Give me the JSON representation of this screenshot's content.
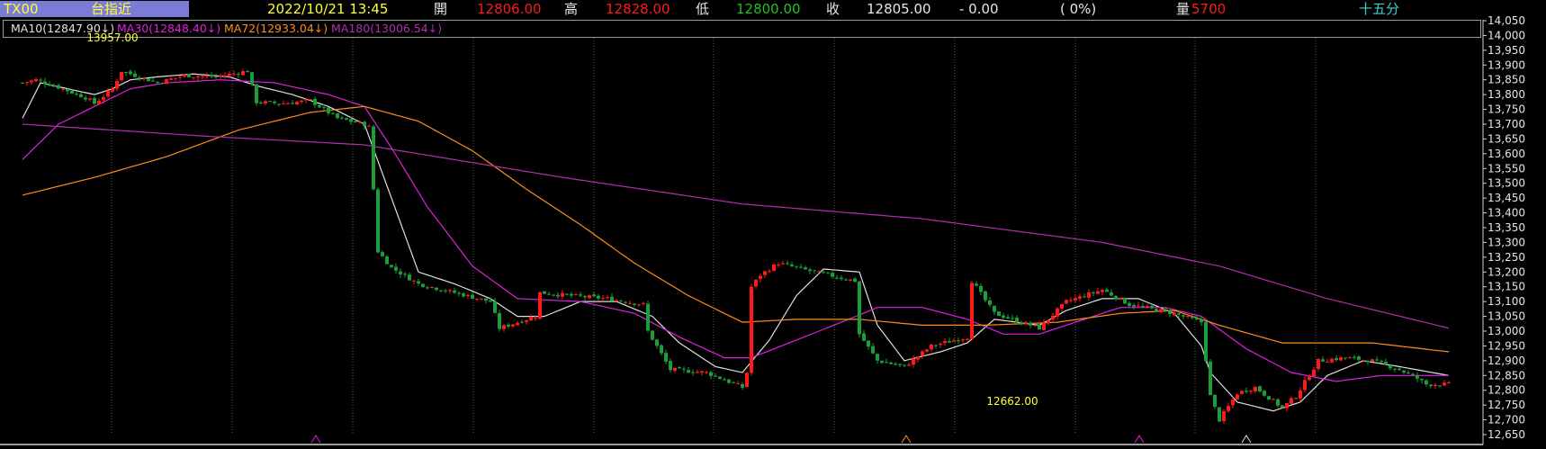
{
  "header": {
    "symbol": "TX00",
    "name": "台指近",
    "datetime": "2022/10/21 13:45",
    "open_label": "開",
    "open": "12806.00",
    "high_label": "高",
    "high": "12828.00",
    "low_label": "低",
    "low": "12800.00",
    "close_label": "收",
    "close": "12805.00",
    "change": "- 0.00",
    "change_pct": "( 0%)",
    "volume_label": "量",
    "volume": "5700",
    "period": "十五分"
  },
  "ma_legend": [
    {
      "label": "MA10",
      "value": "(12847.90↓)",
      "color": "#e0e0e0"
    },
    {
      "label": "MA30",
      "value": "(12848.40↓)",
      "color": "#e020e0"
    },
    {
      "label": "MA72",
      "value": "(12933.04↓)",
      "color": "#ff8c1a"
    },
    {
      "label": "MA180",
      "value": "(13006.54↓)",
      "color": "#b02fb0"
    }
  ],
  "colors": {
    "up": "#ff1a1a",
    "down": "#1a9e3a",
    "grid": "#5a5a5a",
    "accent": "#ffff33"
  },
  "chart_data": {
    "type": "candlestick",
    "ylim": [
      12650,
      14050
    ],
    "y_ticks": [
      "12,650",
      "12,700",
      "12,750",
      "12,800",
      "12,850",
      "12,900",
      "12,950",
      "13,000",
      "13,050",
      "13,100",
      "13,150",
      "13,200",
      "13,250",
      "13,300",
      "13,350",
      "13,400",
      "13,450",
      "13,500",
      "13,550",
      "13,600",
      "13,650",
      "13,700",
      "13,750",
      "13,800",
      "13,850",
      "13,900",
      "13,950",
      "14,000",
      "14,050"
    ],
    "annotations": [
      {
        "text": "13957.00",
        "bar": 20,
        "kind": "high"
      },
      {
        "text": "12662.00",
        "bar": 220,
        "kind": "low"
      }
    ],
    "candle_path": [
      [
        0,
        13840
      ],
      [
        3,
        13850
      ],
      [
        8,
        13825
      ],
      [
        14,
        13790
      ],
      [
        16,
        13770
      ],
      [
        20,
        13820
      ],
      [
        22,
        13880
      ],
      [
        26,
        13860
      ],
      [
        30,
        13840
      ],
      [
        36,
        13865
      ],
      [
        43,
        13860
      ],
      [
        50,
        13880
      ],
      [
        52,
        13775
      ],
      [
        58,
        13770
      ],
      [
        64,
        13780
      ],
      [
        70,
        13720
      ],
      [
        76,
        13700
      ],
      [
        77,
        13690
      ],
      [
        79,
        13270
      ],
      [
        82,
        13215
      ],
      [
        88,
        13160
      ],
      [
        96,
        13130
      ],
      [
        104,
        13100
      ],
      [
        106,
        13010
      ],
      [
        114,
        13050
      ],
      [
        115,
        13130
      ],
      [
        122,
        13120
      ],
      [
        130,
        13110
      ],
      [
        138,
        13090
      ],
      [
        139,
        13000
      ],
      [
        144,
        12870
      ],
      [
        152,
        12860
      ],
      [
        160,
        12810
      ],
      [
        161,
        12860
      ],
      [
        162,
        13150
      ],
      [
        164,
        13190
      ],
      [
        168,
        13230
      ],
      [
        176,
        13200
      ],
      [
        185,
        13170
      ],
      [
        186,
        12990
      ],
      [
        190,
        12900
      ],
      [
        196,
        12880
      ],
      [
        202,
        12950
      ],
      [
        210,
        12980
      ],
      [
        211,
        13170
      ],
      [
        216,
        13060
      ],
      [
        226,
        13010
      ],
      [
        232,
        13100
      ],
      [
        240,
        13140
      ],
      [
        246,
        13090
      ],
      [
        256,
        13060
      ],
      [
        262,
        13030
      ],
      [
        264,
        12780
      ],
      [
        266,
        12700
      ],
      [
        270,
        12790
      ],
      [
        274,
        12810
      ],
      [
        280,
        12740
      ],
      [
        283,
        12780
      ],
      [
        288,
        12900
      ],
      [
        294,
        12910
      ],
      [
        300,
        12900
      ],
      [
        306,
        12870
      ],
      [
        310,
        12840
      ],
      [
        312,
        12820
      ],
      [
        317,
        12820
      ]
    ],
    "ma_series": [
      {
        "name": "MA10",
        "color": "#e0e0e0",
        "path": [
          [
            0,
            13720
          ],
          [
            4,
            13840
          ],
          [
            10,
            13820
          ],
          [
            16,
            13800
          ],
          [
            20,
            13820
          ],
          [
            24,
            13850
          ],
          [
            30,
            13860
          ],
          [
            38,
            13870
          ],
          [
            46,
            13860
          ],
          [
            52,
            13830
          ],
          [
            60,
            13800
          ],
          [
            68,
            13760
          ],
          [
            76,
            13700
          ],
          [
            82,
            13450
          ],
          [
            88,
            13200
          ],
          [
            96,
            13160
          ],
          [
            104,
            13110
          ],
          [
            110,
            13050
          ],
          [
            116,
            13050
          ],
          [
            124,
            13100
          ],
          [
            132,
            13100
          ],
          [
            140,
            13050
          ],
          [
            146,
            12960
          ],
          [
            154,
            12880
          ],
          [
            160,
            12860
          ],
          [
            166,
            12970
          ],
          [
            172,
            13120
          ],
          [
            178,
            13210
          ],
          [
            186,
            13200
          ],
          [
            190,
            13020
          ],
          [
            196,
            12900
          ],
          [
            204,
            12930
          ],
          [
            210,
            12960
          ],
          [
            216,
            13040
          ],
          [
            226,
            13020
          ],
          [
            232,
            13070
          ],
          [
            240,
            13110
          ],
          [
            248,
            13110
          ],
          [
            256,
            13060
          ],
          [
            262,
            12950
          ],
          [
            264,
            12860
          ],
          [
            270,
            12760
          ],
          [
            278,
            12730
          ],
          [
            284,
            12760
          ],
          [
            290,
            12850
          ],
          [
            298,
            12900
          ],
          [
            306,
            12880
          ],
          [
            317,
            12850
          ]
        ]
      },
      {
        "name": "MA30",
        "color": "#e020e0",
        "path": [
          [
            0,
            13580
          ],
          [
            8,
            13700
          ],
          [
            16,
            13760
          ],
          [
            24,
            13820
          ],
          [
            32,
            13840
          ],
          [
            44,
            13850
          ],
          [
            56,
            13840
          ],
          [
            68,
            13800
          ],
          [
            76,
            13760
          ],
          [
            82,
            13620
          ],
          [
            90,
            13420
          ],
          [
            100,
            13220
          ],
          [
            110,
            13110
          ],
          [
            124,
            13100
          ],
          [
            136,
            13060
          ],
          [
            146,
            12980
          ],
          [
            156,
            12910
          ],
          [
            162,
            12910
          ],
          [
            172,
            12970
          ],
          [
            182,
            13030
          ],
          [
            190,
            13080
          ],
          [
            200,
            13080
          ],
          [
            210,
            13040
          ],
          [
            218,
            12990
          ],
          [
            226,
            12990
          ],
          [
            234,
            13030
          ],
          [
            244,
            13080
          ],
          [
            254,
            13080
          ],
          [
            262,
            13050
          ],
          [
            272,
            12940
          ],
          [
            282,
            12860
          ],
          [
            292,
            12830
          ],
          [
            302,
            12850
          ],
          [
            317,
            12850
          ]
        ]
      },
      {
        "name": "MA72",
        "color": "#ff8c1a",
        "path": [
          [
            0,
            13460
          ],
          [
            16,
            13520
          ],
          [
            32,
            13590
          ],
          [
            48,
            13680
          ],
          [
            64,
            13740
          ],
          [
            76,
            13760
          ],
          [
            88,
            13710
          ],
          [
            100,
            13610
          ],
          [
            112,
            13480
          ],
          [
            124,
            13360
          ],
          [
            136,
            13230
          ],
          [
            148,
            13120
          ],
          [
            160,
            13030
          ],
          [
            172,
            13040
          ],
          [
            186,
            13040
          ],
          [
            200,
            13020
          ],
          [
            214,
            13020
          ],
          [
            230,
            13030
          ],
          [
            244,
            13060
          ],
          [
            256,
            13070
          ],
          [
            266,
            13020
          ],
          [
            280,
            12960
          ],
          [
            300,
            12960
          ],
          [
            317,
            12930
          ]
        ]
      },
      {
        "name": "MA180",
        "color": "#b02fb0",
        "path": [
          [
            0,
            13700
          ],
          [
            40,
            13660
          ],
          [
            76,
            13630
          ],
          [
            120,
            13520
          ],
          [
            160,
            13430
          ],
          [
            200,
            13380
          ],
          [
            240,
            13300
          ],
          [
            266,
            13220
          ],
          [
            290,
            13110
          ],
          [
            317,
            13010
          ]
        ]
      }
    ]
  }
}
